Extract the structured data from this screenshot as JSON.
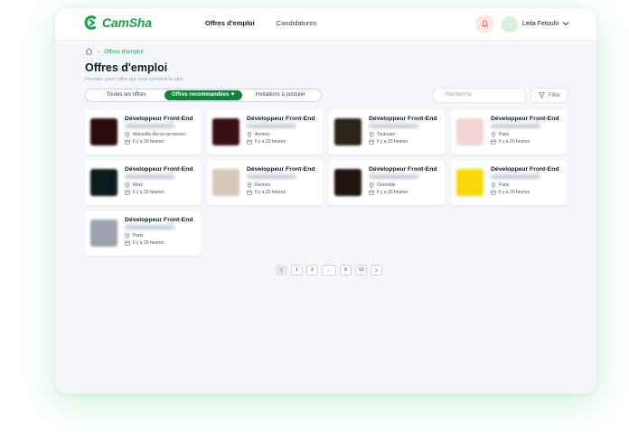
{
  "app": {
    "name": "CamSha"
  },
  "nav": {
    "items": [
      "Offres d'emploi",
      "Candidatures"
    ]
  },
  "user": {
    "name": "Leila Fetouhi"
  },
  "breadcrumb": {
    "current": "Offres d'emploi"
  },
  "page": {
    "title": "Offres d'emploi",
    "subtitle": "Postuler pour l'offre qui vous convient le plus"
  },
  "tabs": [
    "Toutes les offres",
    "Offres recommandées",
    "Invitations à postuler"
  ],
  "search": {
    "placeholder": "Recherche"
  },
  "filter": {
    "label": "Filter"
  },
  "jobs": [
    {
      "title": "Développeur Front-End",
      "location": "Marseille-Aix-en-provence",
      "time": "Il y a 20 heures",
      "logo_color": "#2a0a0a"
    },
    {
      "title": "Développeur Front-End",
      "location": "Annecy",
      "time": "Il y a 20 heures",
      "logo_color": "#3a0f14"
    },
    {
      "title": "Développeur Front-End",
      "location": "Toulouse",
      "time": "Il y a 20 heures",
      "logo_color": "#2b2418"
    },
    {
      "title": "Développeur Front-End",
      "location": "Paris",
      "time": "Il y a 20 heures",
      "logo_color": "#f3d4d4"
    },
    {
      "title": "Développeur Front-End",
      "location": "Metz",
      "time": "Il y a 20 heures",
      "logo_color": "#0d1b1f"
    },
    {
      "title": "Développeur Front-End",
      "location": "Rennes",
      "time": "Il y a 20 heures",
      "logo_color": "#d8c8b8"
    },
    {
      "title": "Développeur Front-End",
      "location": "Grenoble",
      "time": "Il y a 20 heures",
      "logo_color": "#1f1410"
    },
    {
      "title": "Développeur Front-End",
      "location": "Paris",
      "time": "Il y a 20 heures",
      "logo_color": "#f5d90a"
    },
    {
      "title": "Développeur Front-End",
      "location": "Paris",
      "time": "Il y a 20 heures",
      "logo_color": "#9ca3af"
    }
  ],
  "pagination": {
    "pages": [
      "1",
      "2",
      "...",
      "9",
      "10"
    ]
  },
  "colors": {
    "accent": "#15803d",
    "brand": "#16a34a"
  }
}
